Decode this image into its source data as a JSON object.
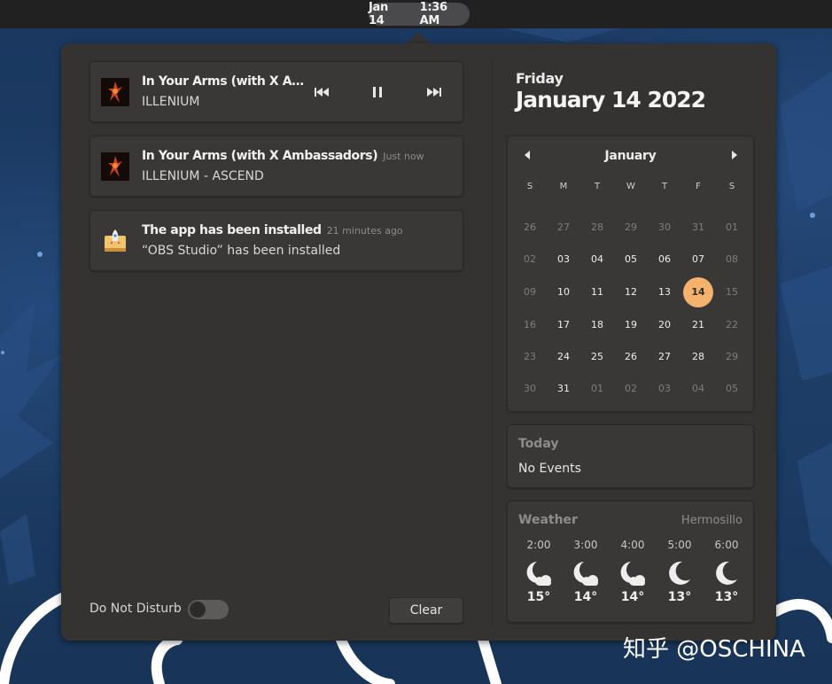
{
  "topbar": {
    "date": "Jan 14",
    "time": "1:36 AM"
  },
  "notifications": [
    {
      "title": "In Your Arms (with X A…",
      "subtitle": "ILLENIUM",
      "type": "media-player"
    },
    {
      "title": "In Your Arms (with X Ambassadors)",
      "time_ago": "Just now",
      "subtitle": "ILLENIUM - ASCEND",
      "type": "media"
    },
    {
      "title": "The app has been installed",
      "time_ago": "21 minutes ago",
      "subtitle": "“OBS Studio” has been installed",
      "type": "app"
    }
  ],
  "media_controls": {
    "prev_icon": "skip-previous-icon",
    "pause_icon": "pause-icon",
    "next_icon": "skip-next-icon"
  },
  "do_not_disturb": {
    "label": "Do Not Disturb",
    "enabled": false
  },
  "clear_label": "Clear",
  "date_header": {
    "day_name": "Friday",
    "full_date": "January 14 2022"
  },
  "calendar": {
    "month": "January",
    "weekdays": [
      "S",
      "M",
      "T",
      "W",
      "T",
      "F",
      "S"
    ],
    "today": "14",
    "weeks": [
      [
        {
          "d": "26",
          "in": false
        },
        {
          "d": "27",
          "in": false
        },
        {
          "d": "28",
          "in": false
        },
        {
          "d": "29",
          "in": false
        },
        {
          "d": "30",
          "in": false
        },
        {
          "d": "31",
          "in": false
        },
        {
          "d": "01",
          "in": false
        }
      ],
      [
        {
          "d": "02",
          "in": false
        },
        {
          "d": "03",
          "in": true
        },
        {
          "d": "04",
          "in": true
        },
        {
          "d": "05",
          "in": true
        },
        {
          "d": "06",
          "in": true
        },
        {
          "d": "07",
          "in": true
        },
        {
          "d": "08",
          "in": false
        }
      ],
      [
        {
          "d": "09",
          "in": false
        },
        {
          "d": "10",
          "in": true
        },
        {
          "d": "11",
          "in": true
        },
        {
          "d": "12",
          "in": true
        },
        {
          "d": "13",
          "in": true
        },
        {
          "d": "14",
          "in": true
        },
        {
          "d": "15",
          "in": false
        }
      ],
      [
        {
          "d": "16",
          "in": false
        },
        {
          "d": "17",
          "in": true
        },
        {
          "d": "18",
          "in": true
        },
        {
          "d": "19",
          "in": true
        },
        {
          "d": "20",
          "in": true
        },
        {
          "d": "21",
          "in": true
        },
        {
          "d": "22",
          "in": false
        }
      ],
      [
        {
          "d": "23",
          "in": false
        },
        {
          "d": "24",
          "in": true
        },
        {
          "d": "25",
          "in": true
        },
        {
          "d": "26",
          "in": true
        },
        {
          "d": "27",
          "in": true
        },
        {
          "d": "28",
          "in": true
        },
        {
          "d": "29",
          "in": false
        }
      ],
      [
        {
          "d": "30",
          "in": false
        },
        {
          "d": "31",
          "in": true
        },
        {
          "d": "01",
          "in": false
        },
        {
          "d": "02",
          "in": false
        },
        {
          "d": "03",
          "in": false
        },
        {
          "d": "04",
          "in": false
        },
        {
          "d": "05",
          "in": false
        }
      ]
    ]
  },
  "events": {
    "heading": "Today",
    "body": "No Events"
  },
  "weather": {
    "heading": "Weather",
    "location": "Hermosillo",
    "hours": [
      {
        "time": "2:00",
        "temp": "15°",
        "icon": "moon-cloud-icon"
      },
      {
        "time": "3:00",
        "temp": "14°",
        "icon": "moon-cloud-icon"
      },
      {
        "time": "4:00",
        "temp": "14°",
        "icon": "moon-cloud-icon"
      },
      {
        "time": "5:00",
        "temp": "13°",
        "icon": "moon-icon"
      },
      {
        "time": "6:00",
        "temp": "13°",
        "icon": "moon-icon"
      }
    ]
  },
  "watermark": "知乎 @OSCHINA"
}
